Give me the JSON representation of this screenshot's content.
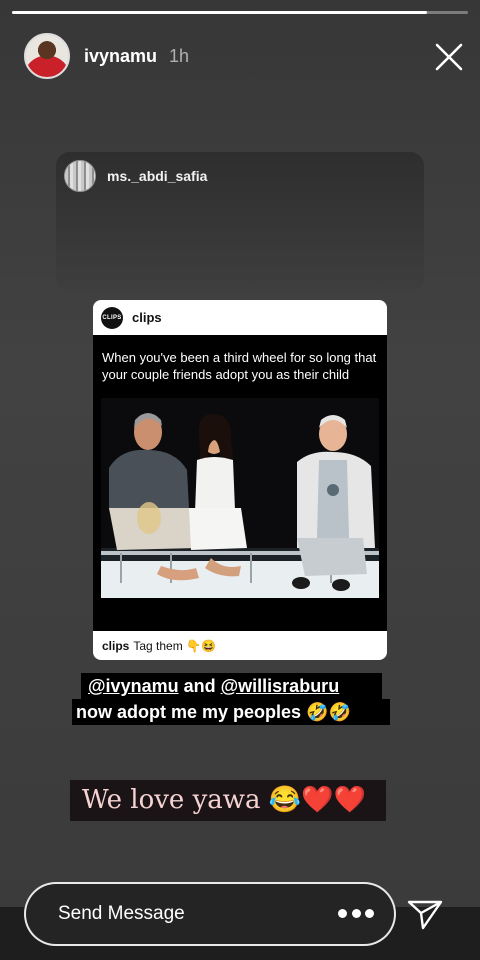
{
  "story": {
    "username": "ivynamu",
    "posted_ago": "1h",
    "progress": 0.91,
    "close_icon": "close-icon"
  },
  "shared_post": {
    "original_user": "ms._abdi_safia",
    "account": "clips",
    "logo_text": "CLIPS",
    "caption": "When you've been a third wheel for so long that your couple friends adopt you as their child",
    "footer_user": "clips",
    "footer_text": "Tag them 👇😆"
  },
  "overlay_text": {
    "mention1": "@ivynamu",
    "connector": " and ",
    "mention2": "@willisraburu",
    "line2": "now adopt me my peoples 🤣🤣",
    "love_text": "We love yawa ",
    "love_emoji": "😂",
    "hearts": "❤️❤️"
  },
  "reply": {
    "placeholder": "Send Message",
    "more_icon": "more-dots-icon",
    "send_icon": "send-icon"
  },
  "colors": {
    "background": "#1e1e1e",
    "mention_highlight": "#000000",
    "love_text": "#f6d2d2",
    "heart_red": "#ff2d35"
  }
}
